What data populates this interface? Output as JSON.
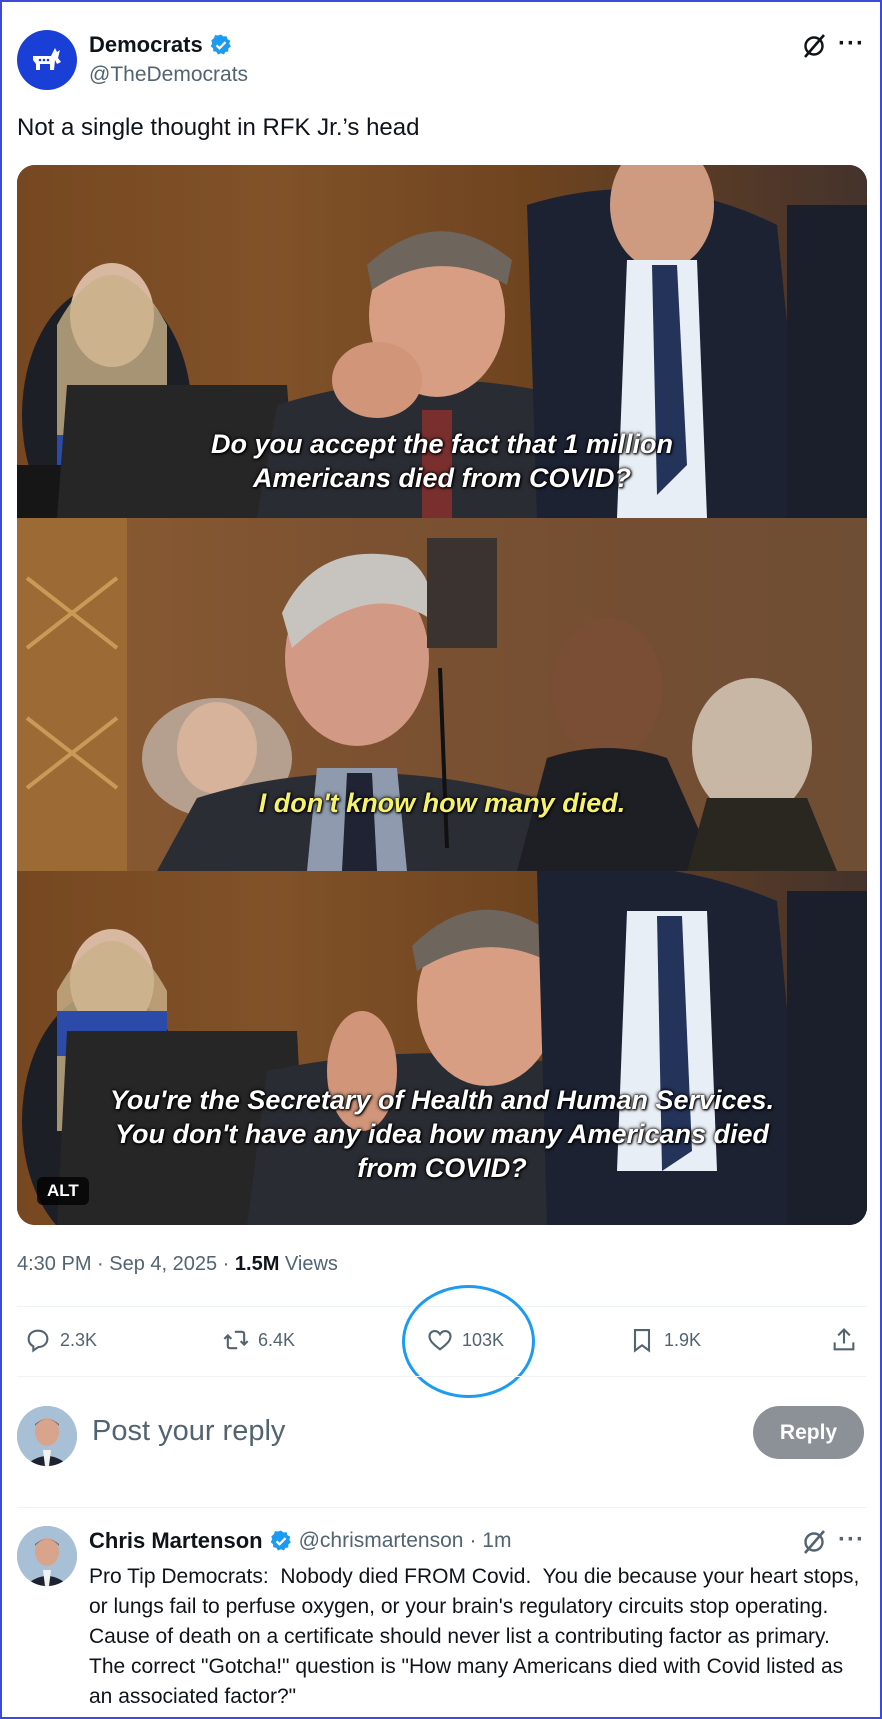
{
  "post": {
    "author_name": "Democrats",
    "author_handle": "@TheDemocrats",
    "text": "Not a single thought in RFK Jr.’s head",
    "media": {
      "caption_1": [
        "Do you accept the fact that 1 million",
        "Americans died from COVID?"
      ],
      "caption_2": [
        "I don't know how many died."
      ],
      "caption_3": [
        "You're the Secretary of Health and Human Services.",
        "You don't have any idea how many Americans died",
        "from COVID?"
      ],
      "alt_badge": "ALT"
    },
    "timestamp": "4:30 PM · Sep 4, 2025 · ",
    "views_count": "1.5M",
    "views_label": " Views",
    "actions": {
      "replies": "2.3K",
      "reposts": "6.4K",
      "likes": "103K",
      "bookmarks": "1.9K"
    },
    "icons": [
      "grok-icon",
      "more-icon",
      "verified-icon",
      "reply-icon",
      "repost-icon",
      "like-icon",
      "bookmark-icon",
      "share-icon"
    ],
    "colors": {
      "accent": "#1d9bf0",
      "highlight_circle": "#1d9bf0",
      "secondary_text": "#536471"
    }
  },
  "composer": {
    "placeholder": "Post your reply",
    "reply_button": "Reply"
  },
  "reply": {
    "author_name": "Chris Martenson",
    "author_handle": "@chrismartenson",
    "time": " · 1m",
    "text": "Pro Tip Democrats:  Nobody died FROM Covid.  You die because your heart stops, or lungs fail to perfuse oxygen, or your brain's regulatory circuits stop operating.  Cause of death on a certificate should never list a contributing factor as primary.  The correct \"Gotcha!\" question is \"How many Americans died with Covid listed as an associated factor?\""
  }
}
